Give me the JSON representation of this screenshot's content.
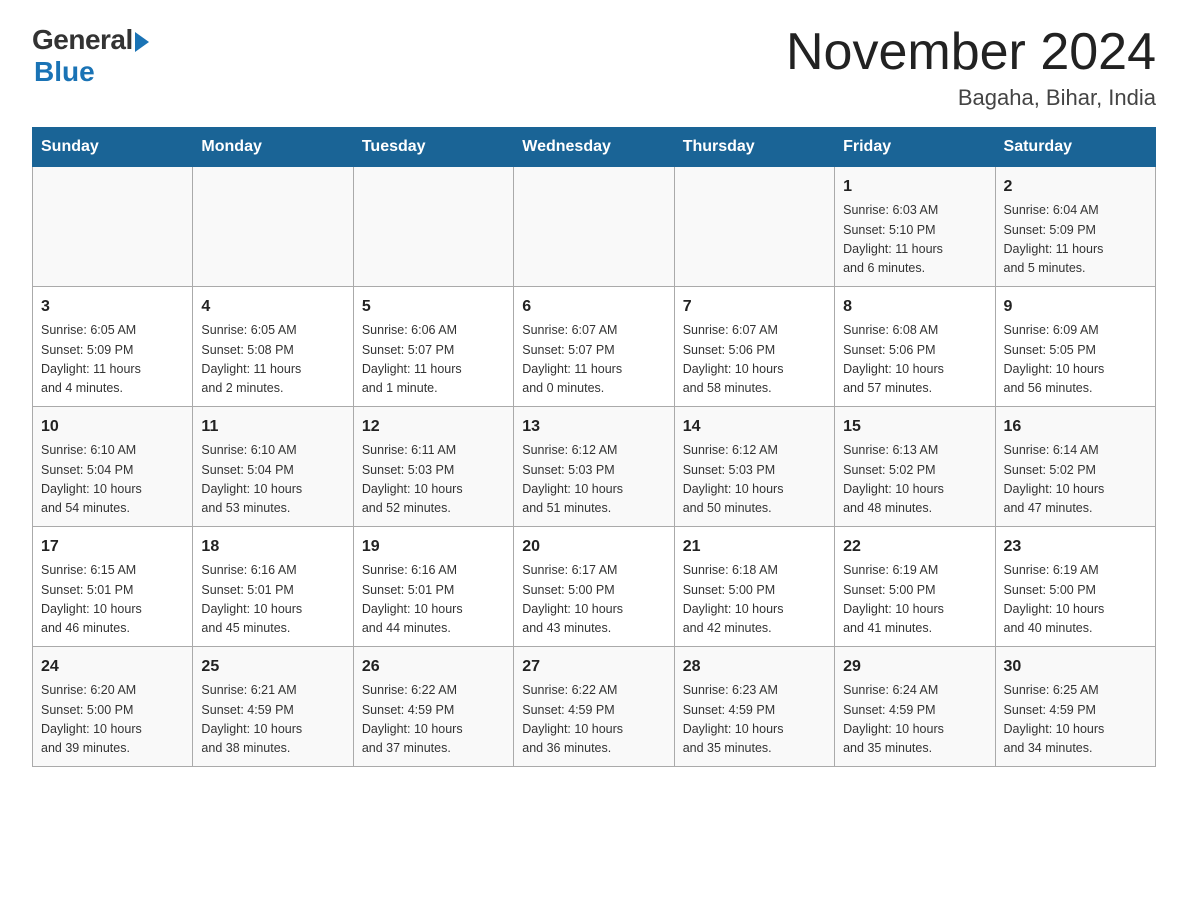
{
  "header": {
    "logo_general": "General",
    "logo_blue": "Blue",
    "title": "November 2024",
    "subtitle": "Bagaha, Bihar, India"
  },
  "weekdays": [
    "Sunday",
    "Monday",
    "Tuesday",
    "Wednesday",
    "Thursday",
    "Friday",
    "Saturday"
  ],
  "weeks": [
    [
      {
        "day": "",
        "info": ""
      },
      {
        "day": "",
        "info": ""
      },
      {
        "day": "",
        "info": ""
      },
      {
        "day": "",
        "info": ""
      },
      {
        "day": "",
        "info": ""
      },
      {
        "day": "1",
        "info": "Sunrise: 6:03 AM\nSunset: 5:10 PM\nDaylight: 11 hours\nand 6 minutes."
      },
      {
        "day": "2",
        "info": "Sunrise: 6:04 AM\nSunset: 5:09 PM\nDaylight: 11 hours\nand 5 minutes."
      }
    ],
    [
      {
        "day": "3",
        "info": "Sunrise: 6:05 AM\nSunset: 5:09 PM\nDaylight: 11 hours\nand 4 minutes."
      },
      {
        "day": "4",
        "info": "Sunrise: 6:05 AM\nSunset: 5:08 PM\nDaylight: 11 hours\nand 2 minutes."
      },
      {
        "day": "5",
        "info": "Sunrise: 6:06 AM\nSunset: 5:07 PM\nDaylight: 11 hours\nand 1 minute."
      },
      {
        "day": "6",
        "info": "Sunrise: 6:07 AM\nSunset: 5:07 PM\nDaylight: 11 hours\nand 0 minutes."
      },
      {
        "day": "7",
        "info": "Sunrise: 6:07 AM\nSunset: 5:06 PM\nDaylight: 10 hours\nand 58 minutes."
      },
      {
        "day": "8",
        "info": "Sunrise: 6:08 AM\nSunset: 5:06 PM\nDaylight: 10 hours\nand 57 minutes."
      },
      {
        "day": "9",
        "info": "Sunrise: 6:09 AM\nSunset: 5:05 PM\nDaylight: 10 hours\nand 56 minutes."
      }
    ],
    [
      {
        "day": "10",
        "info": "Sunrise: 6:10 AM\nSunset: 5:04 PM\nDaylight: 10 hours\nand 54 minutes."
      },
      {
        "day": "11",
        "info": "Sunrise: 6:10 AM\nSunset: 5:04 PM\nDaylight: 10 hours\nand 53 minutes."
      },
      {
        "day": "12",
        "info": "Sunrise: 6:11 AM\nSunset: 5:03 PM\nDaylight: 10 hours\nand 52 minutes."
      },
      {
        "day": "13",
        "info": "Sunrise: 6:12 AM\nSunset: 5:03 PM\nDaylight: 10 hours\nand 51 minutes."
      },
      {
        "day": "14",
        "info": "Sunrise: 6:12 AM\nSunset: 5:03 PM\nDaylight: 10 hours\nand 50 minutes."
      },
      {
        "day": "15",
        "info": "Sunrise: 6:13 AM\nSunset: 5:02 PM\nDaylight: 10 hours\nand 48 minutes."
      },
      {
        "day": "16",
        "info": "Sunrise: 6:14 AM\nSunset: 5:02 PM\nDaylight: 10 hours\nand 47 minutes."
      }
    ],
    [
      {
        "day": "17",
        "info": "Sunrise: 6:15 AM\nSunset: 5:01 PM\nDaylight: 10 hours\nand 46 minutes."
      },
      {
        "day": "18",
        "info": "Sunrise: 6:16 AM\nSunset: 5:01 PM\nDaylight: 10 hours\nand 45 minutes."
      },
      {
        "day": "19",
        "info": "Sunrise: 6:16 AM\nSunset: 5:01 PM\nDaylight: 10 hours\nand 44 minutes."
      },
      {
        "day": "20",
        "info": "Sunrise: 6:17 AM\nSunset: 5:00 PM\nDaylight: 10 hours\nand 43 minutes."
      },
      {
        "day": "21",
        "info": "Sunrise: 6:18 AM\nSunset: 5:00 PM\nDaylight: 10 hours\nand 42 minutes."
      },
      {
        "day": "22",
        "info": "Sunrise: 6:19 AM\nSunset: 5:00 PM\nDaylight: 10 hours\nand 41 minutes."
      },
      {
        "day": "23",
        "info": "Sunrise: 6:19 AM\nSunset: 5:00 PM\nDaylight: 10 hours\nand 40 minutes."
      }
    ],
    [
      {
        "day": "24",
        "info": "Sunrise: 6:20 AM\nSunset: 5:00 PM\nDaylight: 10 hours\nand 39 minutes."
      },
      {
        "day": "25",
        "info": "Sunrise: 6:21 AM\nSunset: 4:59 PM\nDaylight: 10 hours\nand 38 minutes."
      },
      {
        "day": "26",
        "info": "Sunrise: 6:22 AM\nSunset: 4:59 PM\nDaylight: 10 hours\nand 37 minutes."
      },
      {
        "day": "27",
        "info": "Sunrise: 6:22 AM\nSunset: 4:59 PM\nDaylight: 10 hours\nand 36 minutes."
      },
      {
        "day": "28",
        "info": "Sunrise: 6:23 AM\nSunset: 4:59 PM\nDaylight: 10 hours\nand 35 minutes."
      },
      {
        "day": "29",
        "info": "Sunrise: 6:24 AM\nSunset: 4:59 PM\nDaylight: 10 hours\nand 35 minutes."
      },
      {
        "day": "30",
        "info": "Sunrise: 6:25 AM\nSunset: 4:59 PM\nDaylight: 10 hours\nand 34 minutes."
      }
    ]
  ]
}
